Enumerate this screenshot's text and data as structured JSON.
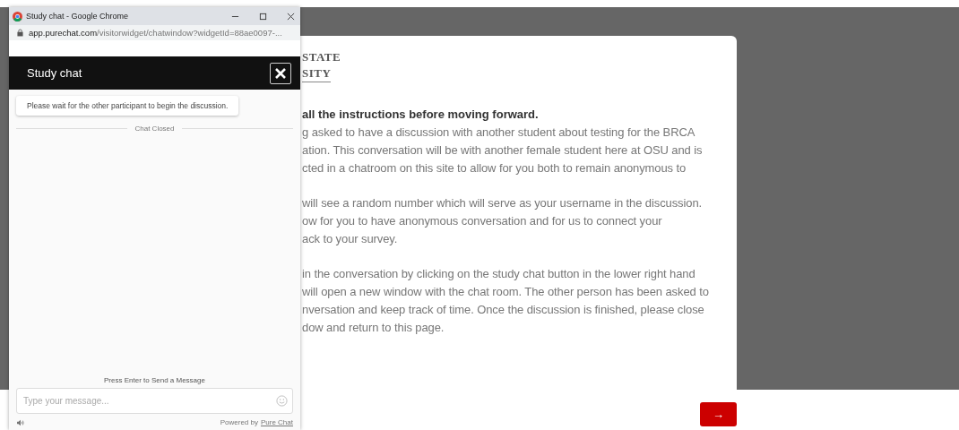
{
  "browser_window": {
    "title": "Study chat - Google Chrome",
    "url_domain": "app.purechat.com",
    "url_path": "/visitorwidget/chatwindow?widgetId=88ae0097-..."
  },
  "chat": {
    "title": "Study chat",
    "notice": "Please wait for the other participant to begin the discussion.",
    "divider_label": "Chat Closed",
    "hint": "Press Enter to Send a Message",
    "input": {
      "placeholder": "Type your message..."
    },
    "footer_text": "Powered by",
    "footer_link": "Pure Chat"
  },
  "survey": {
    "logo_lines": [
      "STATE",
      "SITY"
    ],
    "heading": "all the instructions before moving forward.",
    "paragraphs": [
      [
        "g asked to have a discussion with another student about testing for the BRCA",
        "ation. This conversation will be with another female student here at OSU and is",
        "cted in a chatroom on this site to allow for you both to remain anonymous to"
      ],
      [
        "will see a random number which will serve as your username in the discussion.",
        "ow for you to have anonymous conversation and for us to connect your",
        "ack to your survey."
      ],
      [
        "in the conversation by clicking on the study chat button in the lower right hand",
        "will open a new window with the chat room. The other person has been asked to",
        "nversation and keep track of time. Once the discussion is finished, please close",
        "dow and return to this page."
      ]
    ],
    "next_button": "→"
  }
}
